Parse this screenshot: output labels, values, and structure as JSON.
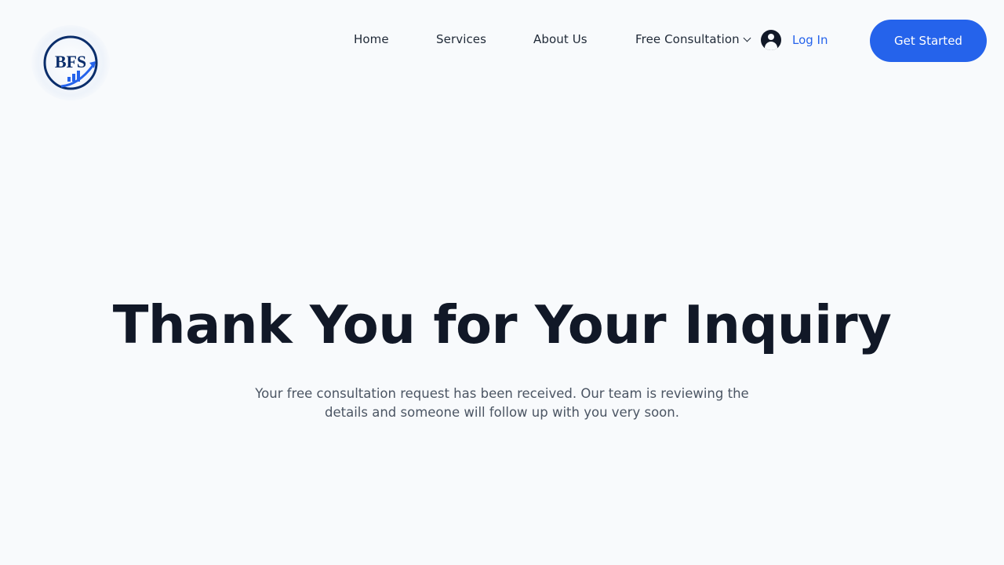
{
  "brand": {
    "logo_text": "BFS",
    "icon": "bfs-logo"
  },
  "nav": {
    "items": [
      {
        "label": "Home"
      },
      {
        "label": "Services"
      },
      {
        "label": "About Us"
      },
      {
        "label": "Free Consultation"
      }
    ],
    "login_label": "Log In",
    "login_icon": "user-avatar-icon",
    "cta_label": "Get Started"
  },
  "hero": {
    "title": "Thank You for Your Inquiry",
    "subtitle": "Your free consultation request has been received. Our team is reviewing the details and someone will follow up with you very soon."
  },
  "colors": {
    "background": "#f8fafc",
    "accent": "#2563eb",
    "heading": "#111827",
    "body_text": "#4b5563",
    "logo_navy": "#0b2e6b"
  }
}
